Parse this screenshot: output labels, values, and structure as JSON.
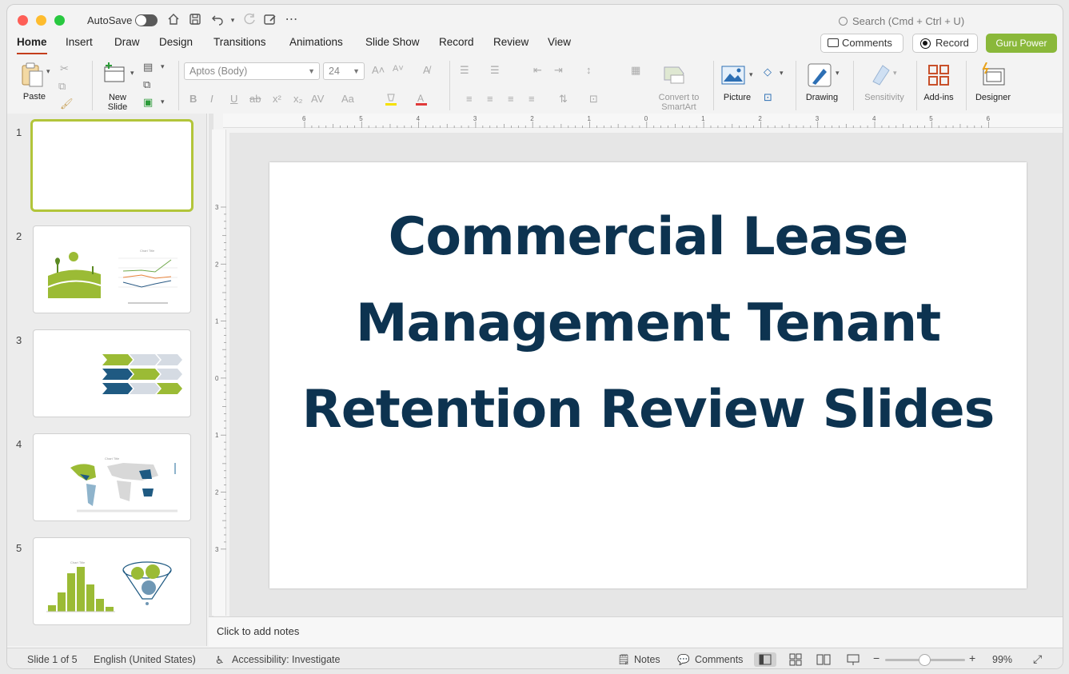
{
  "titlebar": {
    "autosave_label": "AutoSave",
    "search_placeholder": "Search (Cmd + Ctrl + U)"
  },
  "tabs": [
    {
      "label": "Home"
    },
    {
      "label": "Insert"
    },
    {
      "label": "Draw"
    },
    {
      "label": "Design"
    },
    {
      "label": "Transitions"
    },
    {
      "label": "Animations"
    },
    {
      "label": "Slide Show"
    },
    {
      "label": "Record"
    },
    {
      "label": "Review"
    },
    {
      "label": "View"
    }
  ],
  "header_buttons": {
    "comments": "Comments",
    "record": "Record",
    "guru": "Guru Power"
  },
  "ribbon": {
    "paste": "Paste",
    "new_slide_1": "New",
    "new_slide_2": "Slide",
    "font_name": "Aptos (Body)",
    "font_size": "24",
    "convert_1": "Convert to",
    "convert_2": "SmartArt",
    "picture": "Picture",
    "drawing": "Drawing",
    "sensitivity": "Sensitivity",
    "addins": "Add-ins",
    "designer": "Designer"
  },
  "slides": [
    {
      "num": "1"
    },
    {
      "num": "2"
    },
    {
      "num": "3"
    },
    {
      "num": "4"
    },
    {
      "num": "5"
    }
  ],
  "slide_content": {
    "title": "Commercial Lease Management Tenant Retention Review Slides"
  },
  "notes_placeholder": "Click to add notes",
  "status": {
    "slide_count": "Slide 1 of 5",
    "language": "English (United States)",
    "accessibility": "Accessibility: Investigate",
    "notes": "Notes",
    "comments": "Comments",
    "zoom": "99%"
  },
  "ruler": {
    "top_ticks": [
      "6",
      "5",
      "4",
      "3",
      "2",
      "1",
      "0",
      "1",
      "2",
      "3",
      "4",
      "5",
      "6"
    ],
    "left_ticks": [
      "3",
      "2",
      "1",
      "0",
      "1",
      "2",
      "3"
    ]
  },
  "colors": {
    "accent_tab": "#c43e1c",
    "guru_green": "#8ab83a",
    "title_navy": "#0d3350",
    "thumb_select": "#b2c53a"
  }
}
